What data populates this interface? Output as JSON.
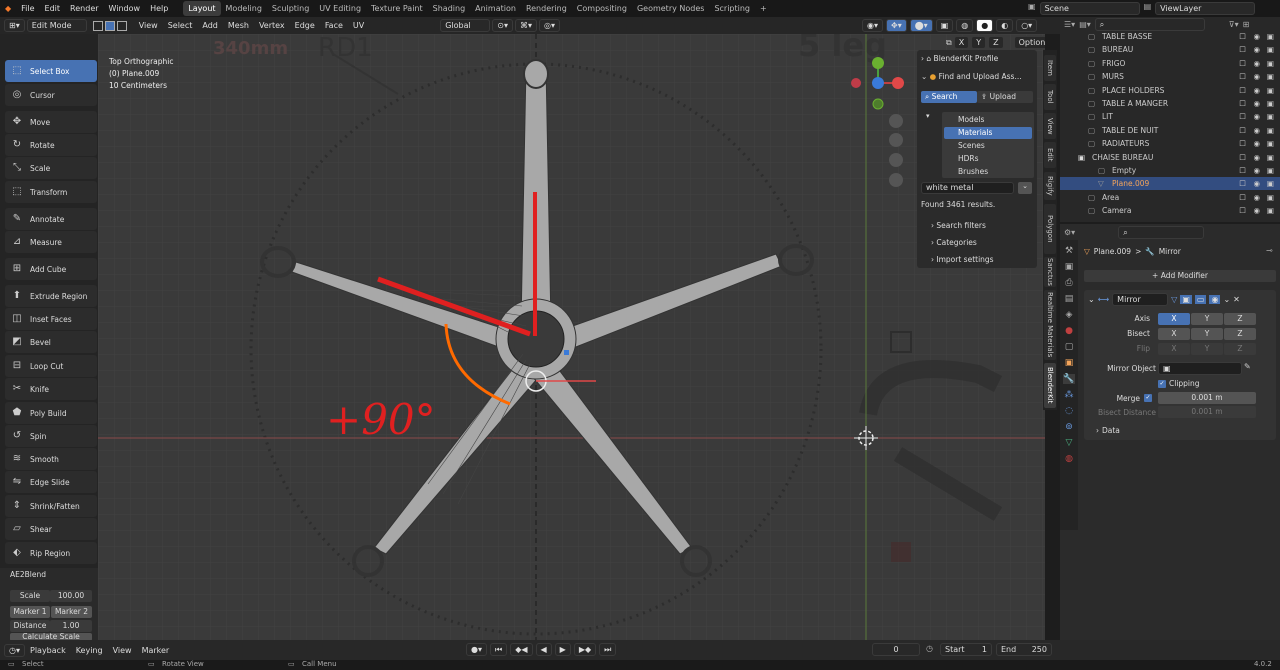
{
  "menu": {
    "items": [
      "File",
      "Edit",
      "Render",
      "Window",
      "Help"
    ]
  },
  "workspaces": [
    "Layout",
    "Modeling",
    "Sculpting",
    "UV Editing",
    "Texture Paint",
    "Shading",
    "Animation",
    "Rendering",
    "Compositing",
    "Geometry Nodes",
    "Scripting"
  ],
  "workspace_add": "+",
  "scene": {
    "name": "Scene",
    "view_layer": "ViewLayer"
  },
  "viewport_header": {
    "mode": "Edit Mode",
    "menus": [
      "View",
      "Select",
      "Add",
      "Mesh",
      "Vertex",
      "Edge",
      "Face",
      "UV"
    ],
    "transform_orientation": "Global",
    "options": "Options",
    "axes": [
      "X",
      "Y",
      "Z"
    ]
  },
  "overlay_text": {
    "view": "Top Orthographic",
    "object": "(0) Plane.009",
    "scale": "10 Centimeters"
  },
  "tools": [
    {
      "label": "Select Box",
      "icon": "select-box-icon",
      "active": true
    },
    {
      "label": "Cursor",
      "icon": "cursor-icon"
    },
    {
      "label": "Move",
      "icon": "move-icon"
    },
    {
      "label": "Rotate",
      "icon": "rotate-icon"
    },
    {
      "label": "Scale",
      "icon": "scale-icon"
    },
    {
      "label": "Transform",
      "icon": "transform-icon"
    },
    {
      "label": "Annotate",
      "icon": "annotate-icon"
    },
    {
      "label": "Measure",
      "icon": "measure-icon"
    },
    {
      "label": "Add Cube",
      "icon": "add-cube-icon"
    },
    {
      "label": "Extrude Region",
      "icon": "extrude-icon"
    },
    {
      "label": "Inset Faces",
      "icon": "inset-icon"
    },
    {
      "label": "Bevel",
      "icon": "bevel-icon"
    },
    {
      "label": "Loop Cut",
      "icon": "loop-cut-icon"
    },
    {
      "label": "Knife",
      "icon": "knife-icon"
    },
    {
      "label": "Poly Build",
      "icon": "poly-build-icon"
    },
    {
      "label": "Spin",
      "icon": "spin-icon"
    },
    {
      "label": "Smooth",
      "icon": "smooth-icon"
    },
    {
      "label": "Edge Slide",
      "icon": "edge-slide-icon"
    },
    {
      "label": "Shrink/Fatten",
      "icon": "shrink-fatten-icon"
    },
    {
      "label": "Shear",
      "icon": "shear-icon"
    },
    {
      "label": "Rip Region",
      "icon": "rip-region-icon"
    }
  ],
  "ae2blend": {
    "title": "AE2Blend",
    "scale_label": "Scale",
    "scale_value": "100.00",
    "marker1": "Marker 1",
    "marker2": "Marker 2",
    "distance_label": "Distance",
    "distance_value": "1.00",
    "calc": "Calculate Scale"
  },
  "reference": {
    "text1": "340mm",
    "text2": "RD1",
    "text3": "5 leg"
  },
  "annotation": {
    "text": "+90°"
  },
  "blenderkit": {
    "profile": "BlenderKit Profile",
    "find": "Find and Upload Ass...",
    "search": "Search",
    "upload": "Upload",
    "categories": [
      "Models",
      "Materials",
      "Scenes",
      "HDRs",
      "Brushes"
    ],
    "selected_category": "Materials",
    "query": "white metal",
    "found": "Found 3461 results.",
    "sections": [
      "Search filters",
      "Categories",
      "Import settings"
    ]
  },
  "side_tabs": [
    "Item",
    "Tool",
    "View",
    "Edit",
    "Rigify",
    "Polygon",
    "Sanctus",
    "Realtime Materials",
    "BlenderKit"
  ],
  "outliner": {
    "search_placeholder": "",
    "items": [
      {
        "name": "TABLE BASSE",
        "indent": 1
      },
      {
        "name": "BUREAU",
        "indent": 1
      },
      {
        "name": "FRIGO",
        "indent": 1
      },
      {
        "name": "MURS",
        "indent": 1
      },
      {
        "name": "PLACE HOLDERS",
        "indent": 1
      },
      {
        "name": "TABLE A MANGER",
        "indent": 1
      },
      {
        "name": "LIT",
        "indent": 1
      },
      {
        "name": "TABLE DE NUIT",
        "indent": 1
      },
      {
        "name": "RADIATEURS",
        "indent": 1
      },
      {
        "name": "CHAISE BUREAU",
        "indent": 1,
        "collection": true
      },
      {
        "name": "Empty",
        "indent": 2
      },
      {
        "name": "Plane.009",
        "indent": 2,
        "selected": true
      },
      {
        "name": "Area",
        "indent": 1
      },
      {
        "name": "Camera",
        "indent": 1
      }
    ]
  },
  "properties": {
    "breadcrumb_object": "Plane.009",
    "breadcrumb_sep": ">",
    "breadcrumb_modifier": "Mirror",
    "add_modifier": "Add Modifier",
    "modifier_name": "Mirror",
    "axis_label": "Axis",
    "bisect_label": "Bisect",
    "flip_label": "Flip",
    "axes": [
      "X",
      "Y",
      "Z"
    ],
    "mirror_object_label": "Mirror Object",
    "clipping_label": "Clipping",
    "merge_label": "Merge",
    "merge_value": "0.001 m",
    "bisect_distance_label": "Bisect Distance",
    "bisect_distance_value": "0.001 m",
    "data_label": "Data"
  },
  "timeline": {
    "playback": "Playback",
    "keying": "Keying",
    "view": "View",
    "marker": "Marker",
    "current_frame": "0",
    "start_label": "Start",
    "start_value": "1",
    "end_label": "End",
    "end_value": "250"
  },
  "statusbar": {
    "select": "Select",
    "rotate": "Rotate View",
    "call_menu": "Call Menu",
    "version": "4.0.2"
  },
  "colors": {
    "accent": "#4772b3",
    "annotation_red": "#e02020",
    "annotation_orange": "#ff6a00",
    "selected_text": "#f5a55a",
    "viewport_bg": "#3a3a3a",
    "mesh": "#a8a8a8"
  }
}
